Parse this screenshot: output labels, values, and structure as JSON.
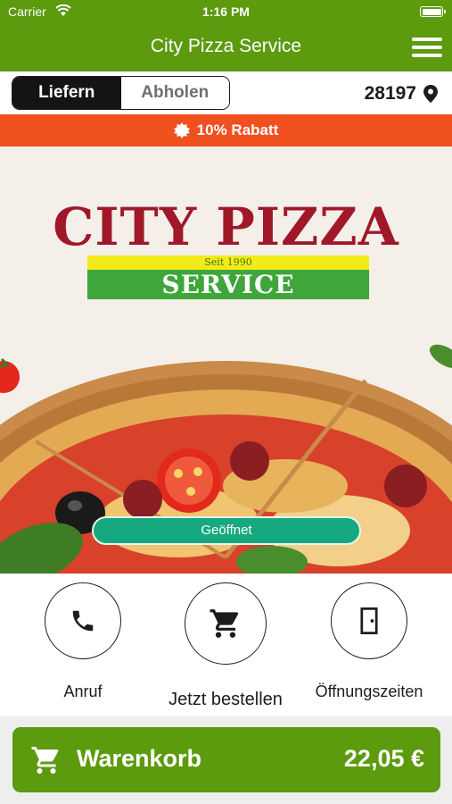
{
  "status_bar": {
    "carrier": "Carrier",
    "time": "1:16 PM"
  },
  "header": {
    "title": "City Pizza Service"
  },
  "mode_toggle": {
    "options": [
      "Liefern",
      "Abholen"
    ],
    "selected": "Liefern"
  },
  "location": {
    "postal_code": "28197"
  },
  "promo": {
    "label": "10% Rabatt"
  },
  "hero": {
    "logo_line1": "CITY PIZZA",
    "logo_tagline": "Seit 1990",
    "logo_line2": "SERVICE",
    "open_status": "Geöffnet"
  },
  "actions": [
    {
      "label": "Anruf",
      "icon": "phone-icon"
    },
    {
      "label": "Jetzt bestellen",
      "icon": "cart-icon"
    },
    {
      "label": "Öffnungszeiten",
      "icon": "door-icon"
    }
  ],
  "cart": {
    "label": "Warenkorb",
    "total": "22,05 €"
  },
  "colors": {
    "primary_green": "#5c9a0e",
    "promo_orange": "#f0501e",
    "status_teal": "#16a87e",
    "logo_red": "#a0172a"
  }
}
